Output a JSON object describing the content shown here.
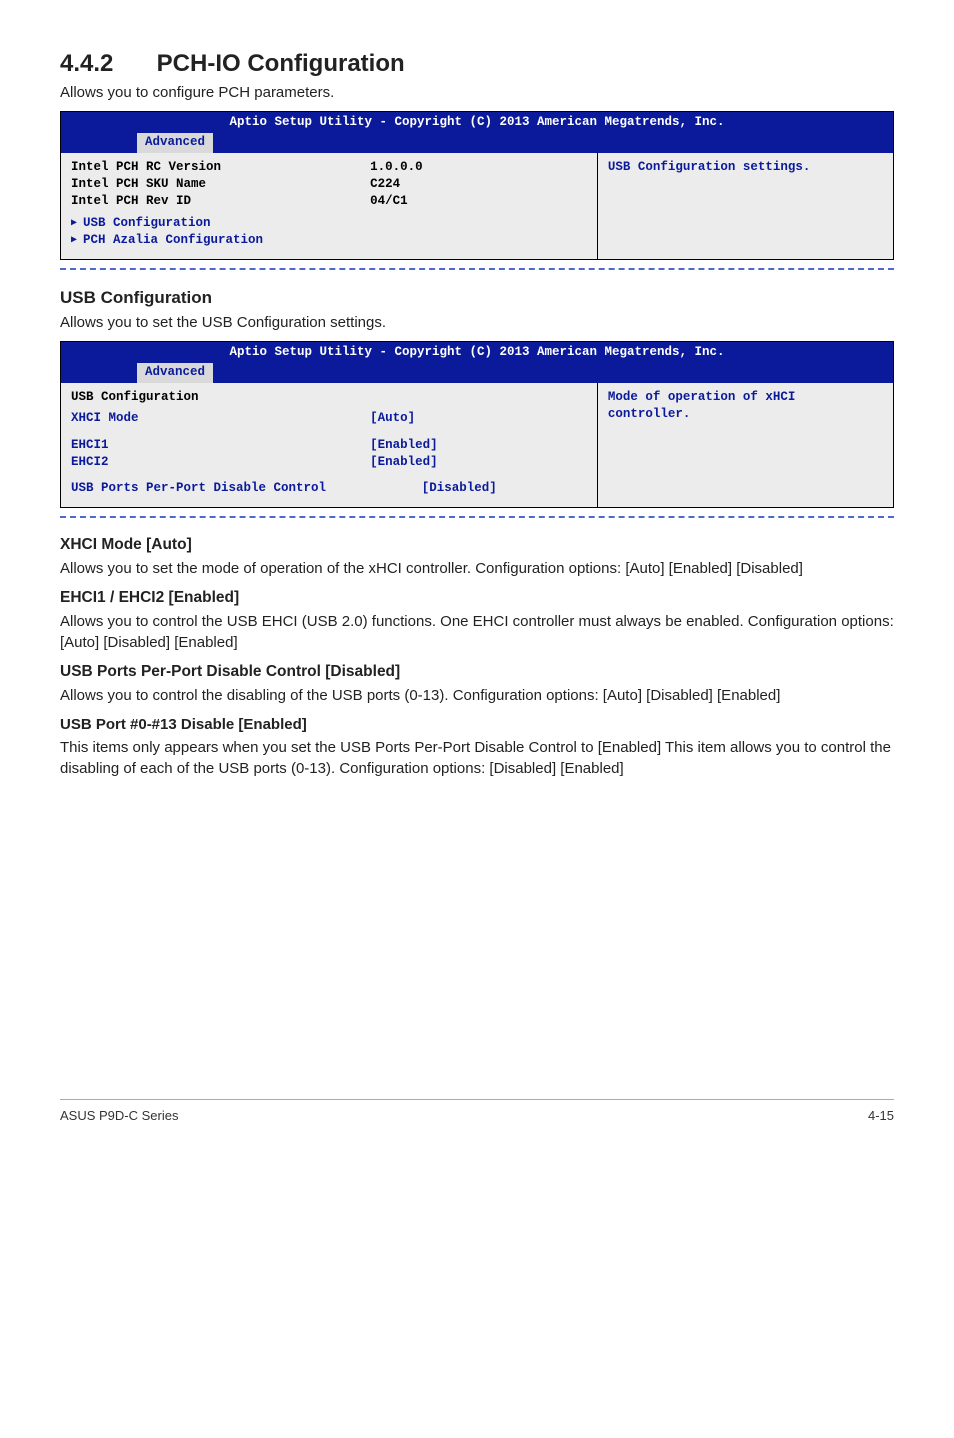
{
  "section": {
    "number": "4.4.2",
    "title": "PCH-IO Configuration",
    "intro": "Allows you to configure PCH parameters."
  },
  "bios1": {
    "header": "Aptio Setup Utility - Copyright (C) 2013 American Megatrends, Inc.",
    "tab": "Advanced",
    "rows": [
      {
        "label": "Intel PCH RC Version",
        "value": "1.0.0.0"
      },
      {
        "label": "Intel PCH SKU Name",
        "value": "C224"
      },
      {
        "label": "Intel PCH Rev ID",
        "value": "04/C1"
      }
    ],
    "submenus": [
      "USB Configuration",
      "PCH Azalia Configuration"
    ],
    "help": "USB Configuration settings."
  },
  "usbcfg": {
    "heading": "USB Configuration",
    "intro": "Allows you to set the USB Configuration settings."
  },
  "bios2": {
    "header": "Aptio Setup Utility - Copyright (C) 2013 American Megatrends, Inc.",
    "tab": "Advanced",
    "title": "USB Configuration",
    "rows": [
      {
        "label": "XHCI Mode",
        "value": "[Auto]"
      },
      {
        "label_blank": ""
      },
      {
        "label": "EHCI1",
        "value": "[Enabled]"
      },
      {
        "label": "EHCI2",
        "value": "[Enabled]"
      },
      {
        "label_blank": ""
      },
      {
        "label": "USB Ports Per-Port Disable Control",
        "value": "[Disabled]"
      }
    ],
    "help": "Mode of operation of xHCI controller."
  },
  "xhci": {
    "heading": "XHCI Mode [Auto]",
    "para": "Allows you to set the mode of operation of the xHCI controller. Configuration options: [Auto] [Enabled] [Disabled]"
  },
  "ehci": {
    "heading": "EHCI1 / EHCI2 [Enabled]",
    "para": "Allows you to control the USB EHCI (USB 2.0) functions. One EHCI controller must always be enabled. Configuration options: [Auto] [Disabled] [Enabled]"
  },
  "usbports": {
    "heading": "USB Ports Per-Port Disable Control [Disabled]",
    "para": "Allows you to control the disabling of the USB ports (0-13). Configuration options: [Auto] [Disabled] [Enabled]"
  },
  "usbportnum": {
    "heading": "USB Port #0-#13 Disable [Enabled]",
    "para": "This items only appears when you set the USB Ports Per-Port Disable Control to [Enabled] This item allows you to control the disabling of each of the USB ports (0-13). Configuration options: [Disabled] [Enabled]"
  },
  "footer": {
    "left": "ASUS P9D-C Series",
    "right": "4-15"
  }
}
